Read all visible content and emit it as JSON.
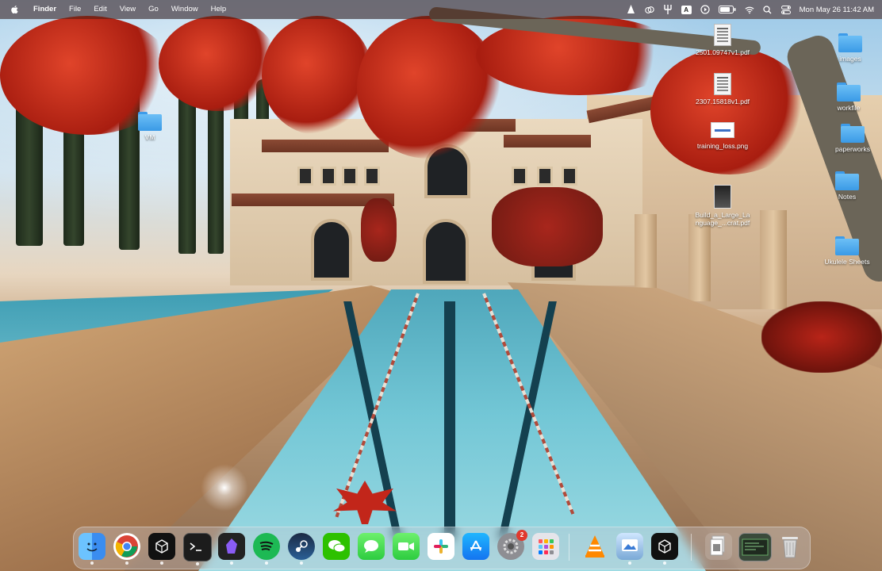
{
  "menubar": {
    "app_name": "Finder",
    "menus": [
      "File",
      "Edit",
      "View",
      "Go",
      "Window",
      "Help"
    ],
    "input_source": "A",
    "datetime": "Mon May 26  11:42 AM"
  },
  "desktop": {
    "icons": [
      {
        "label": "2501.09747v1.pdf",
        "type": "pdf"
      },
      {
        "label": "images",
        "type": "folder"
      },
      {
        "label": "2307.15818v1.pdf",
        "type": "pdf"
      },
      {
        "label": "workfile",
        "type": "folder"
      },
      {
        "label": "VM",
        "type": "folder"
      },
      {
        "label": "training_loss.png",
        "type": "image"
      },
      {
        "label": "paperworks",
        "type": "folder"
      },
      {
        "label": "Notes",
        "type": "folder"
      },
      {
        "label": "Build_a_Large_La",
        "type": "pdf"
      },
      {
        "label": "nguage_...crat.pdf",
        "type": "pdf-line2"
      },
      {
        "label": "Ukulele Sheets",
        "type": "folder"
      }
    ]
  },
  "dock": {
    "apps": [
      {
        "icon": "finder-icon",
        "running": true
      },
      {
        "icon": "chrome-icon",
        "running": true
      },
      {
        "icon": "cube-app-icon",
        "running": true
      },
      {
        "icon": "terminal-icon",
        "running": true
      },
      {
        "icon": "obsidian-icon",
        "running": true
      },
      {
        "icon": "spotify-icon",
        "running": true
      },
      {
        "icon": "steam-icon",
        "running": true
      },
      {
        "icon": "wechat-icon",
        "running": false
      },
      {
        "icon": "messages-icon",
        "running": false
      },
      {
        "icon": "facetime-icon",
        "running": false
      },
      {
        "icon": "slack-icon",
        "running": false
      },
      {
        "icon": "app-store-icon",
        "running": false
      },
      {
        "icon": "system-settings-icon",
        "running": false
      },
      {
        "icon": "launchpad-icon",
        "running": false
      },
      {
        "icon": "vlc-icon",
        "running": false
      },
      {
        "icon": "preview-icon",
        "running": true
      },
      {
        "icon": "cube-app-2-icon",
        "running": true
      },
      {
        "icon": "downloads-stack-icon",
        "running": false
      },
      {
        "icon": "screen-recording-icon",
        "running": false
      },
      {
        "icon": "trash-icon",
        "running": false
      }
    ],
    "settings_badge": "2"
  },
  "colors": {
    "accent_folder": "#3a9ae6",
    "menubar_bg": "#461e14",
    "badge_red": "#e0392e"
  }
}
